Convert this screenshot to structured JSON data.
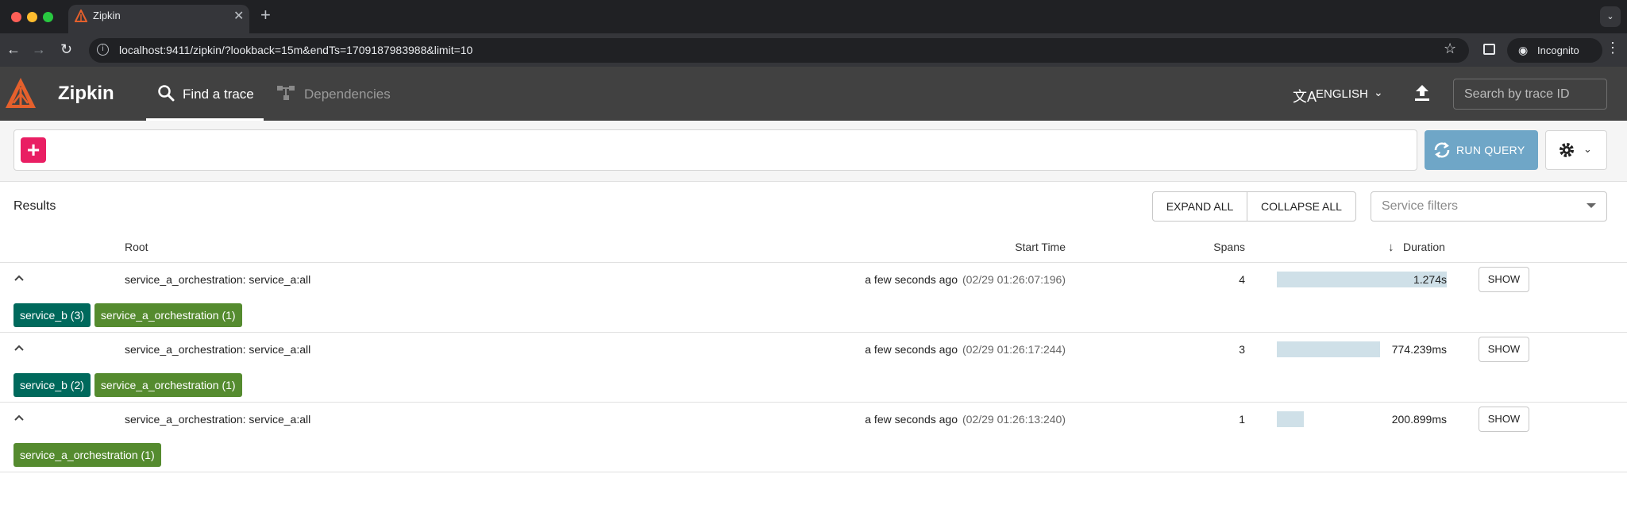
{
  "browser": {
    "tab_title": "Zipkin",
    "url": "localhost:9411/zipkin/?lookback=15m&endTs=1709187983988&limit=10",
    "incognito_label": "Incognito"
  },
  "header": {
    "brand": "Zipkin",
    "nav_find": "Find a trace",
    "nav_dependencies": "Dependencies",
    "language": "ENGLISH",
    "trace_search_placeholder": "Search by trace ID"
  },
  "query": {
    "run_label": "RUN QUERY"
  },
  "results": {
    "title": "Results",
    "expand_all": "EXPAND ALL",
    "collapse_all": "COLLAPSE ALL",
    "service_filters_placeholder": "Service filters",
    "columns": {
      "root": "Root",
      "start_time": "Start Time",
      "spans": "Spans",
      "duration": "Duration"
    },
    "rows": [
      {
        "root": "service_a_orchestration: service_a:all",
        "start_relative": "a few seconds ago",
        "start_absolute": "(02/29 01:26:07:196)",
        "spans": "4",
        "duration": "1.274s",
        "duration_fraction": 1.0,
        "show": "SHOW",
        "badges": [
          {
            "label": "service_b (3)",
            "color": "#00695c"
          },
          {
            "label": "service_a_orchestration (1)",
            "color": "#558b2f"
          }
        ]
      },
      {
        "root": "service_a_orchestration: service_a:all",
        "start_relative": "a few seconds ago",
        "start_absolute": "(02/29 01:26:17:244)",
        "spans": "3",
        "duration": "774.239ms",
        "duration_fraction": 0.608,
        "show": "SHOW",
        "badges": [
          {
            "label": "service_b (2)",
            "color": "#00695c"
          },
          {
            "label": "service_a_orchestration (1)",
            "color": "#558b2f"
          }
        ]
      },
      {
        "root": "service_a_orchestration: service_a:all",
        "start_relative": "a few seconds ago",
        "start_absolute": "(02/29 01:26:13:240)",
        "spans": "1",
        "duration": "200.899ms",
        "duration_fraction": 0.158,
        "show": "SHOW",
        "badges": [
          {
            "label": "service_a_orchestration (1)",
            "color": "#558b2f"
          }
        ]
      }
    ]
  },
  "colors": {
    "brand_accent": "#e5602c",
    "header_bg": "#414141",
    "add_button": "#e91e63",
    "run_button": "#6fa6c7",
    "duration_bar": "#cfe0e8"
  }
}
